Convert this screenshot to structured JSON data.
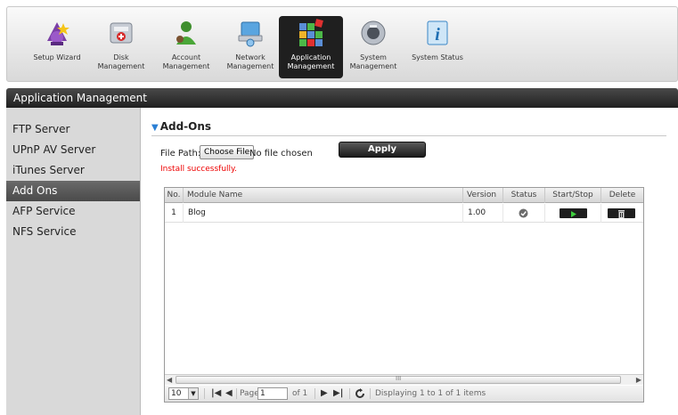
{
  "toolbar": {
    "items": [
      {
        "label_lines": [
          "Setup Wizard",
          ""
        ],
        "icon": "wizard-icon"
      },
      {
        "label_lines": [
          "Disk",
          "Management"
        ],
        "icon": "disk-icon"
      },
      {
        "label_lines": [
          "Account",
          "Management"
        ],
        "icon": "account-icon"
      },
      {
        "label_lines": [
          "Network",
          "Management"
        ],
        "icon": "network-icon"
      },
      {
        "label_lines": [
          "Application",
          "Management"
        ],
        "icon": "application-icon",
        "active": true
      },
      {
        "label_lines": [
          "System",
          "Management"
        ],
        "icon": "system-icon"
      },
      {
        "label_lines": [
          "System Status",
          ""
        ],
        "icon": "info-icon"
      }
    ]
  },
  "section": {
    "title": "Application Management"
  },
  "sidebar": {
    "items": [
      {
        "label": "FTP Server"
      },
      {
        "label": "UPnP AV Server"
      },
      {
        "label": "iTunes Server"
      },
      {
        "label": "Add Ons",
        "active": true
      },
      {
        "label": "AFP Service"
      },
      {
        "label": "NFS Service"
      }
    ]
  },
  "addons": {
    "title": "Add-Ons",
    "file_path_label": "File Path:",
    "choose_file_label": "Choose File",
    "no_file_text": "No file chosen",
    "apply_label": "Apply",
    "status_message": "Install successfully.",
    "colors": {
      "status_message": "#e00000",
      "accent_triangle": "#2a7fd4"
    }
  },
  "table": {
    "columns": [
      "No.",
      "Module Name",
      "Version",
      "Status",
      "Start/Stop",
      "Delete"
    ],
    "rows": [
      {
        "no": "1",
        "module_name": "Blog",
        "version": "1.00",
        "status_icon": "status-check-icon",
        "start_icon": "play-icon",
        "delete_icon": "trash-icon"
      }
    ],
    "scroll_marker": "III"
  },
  "pager": {
    "page_size": "10",
    "page_label": "Page",
    "page_value": "1",
    "of_text": "of 1",
    "display_text": "Displaying 1 to 1 of 1 items"
  }
}
